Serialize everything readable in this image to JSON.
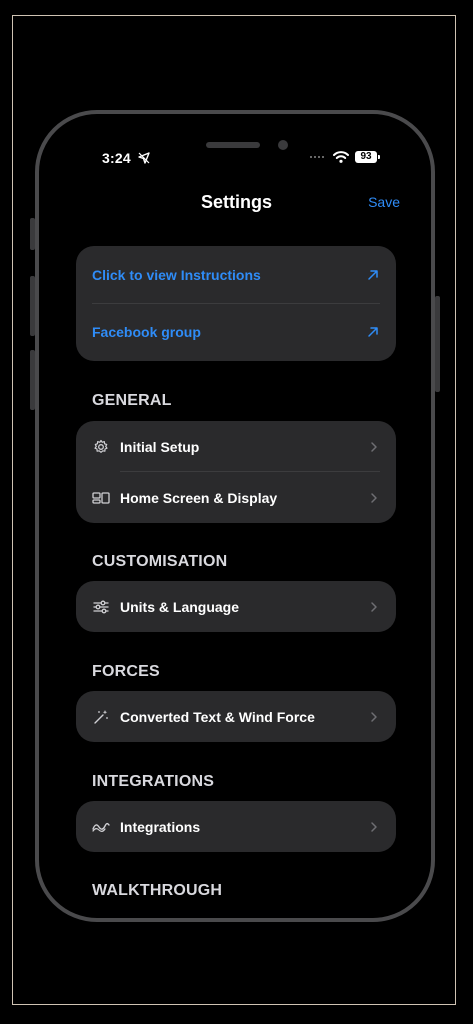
{
  "status": {
    "time": "3:24",
    "battery": "93"
  },
  "nav": {
    "title": "Settings",
    "save_label": "Save"
  },
  "links": [
    {
      "label": "Click to view Instructions",
      "icon": "external-arrow-icon"
    },
    {
      "label": "Facebook group",
      "icon": "external-arrow-icon"
    }
  ],
  "sections": {
    "general": "GENERAL",
    "customisation": "CUSTOMISATION",
    "forces": "FORCES",
    "integrations": "INTEGRATIONS",
    "walkthrough": "WALKTHROUGH"
  },
  "general_items": [
    {
      "label": "Initial Setup",
      "icon": "gear-icon"
    },
    {
      "label": "Home Screen & Display",
      "icon": "layout-icon"
    }
  ],
  "customisation_items": [
    {
      "label": "Units & Language",
      "icon": "sliders-icon"
    }
  ],
  "forces_items": [
    {
      "label": "Converted Text & Wind Force",
      "icon": "magic-wand-icon"
    }
  ],
  "integrations_items": [
    {
      "label": "Integrations",
      "icon": "wave-icon"
    }
  ],
  "colors": {
    "accent": "#2f8cf7",
    "card": "#2a2a2c",
    "background": "#000000"
  }
}
